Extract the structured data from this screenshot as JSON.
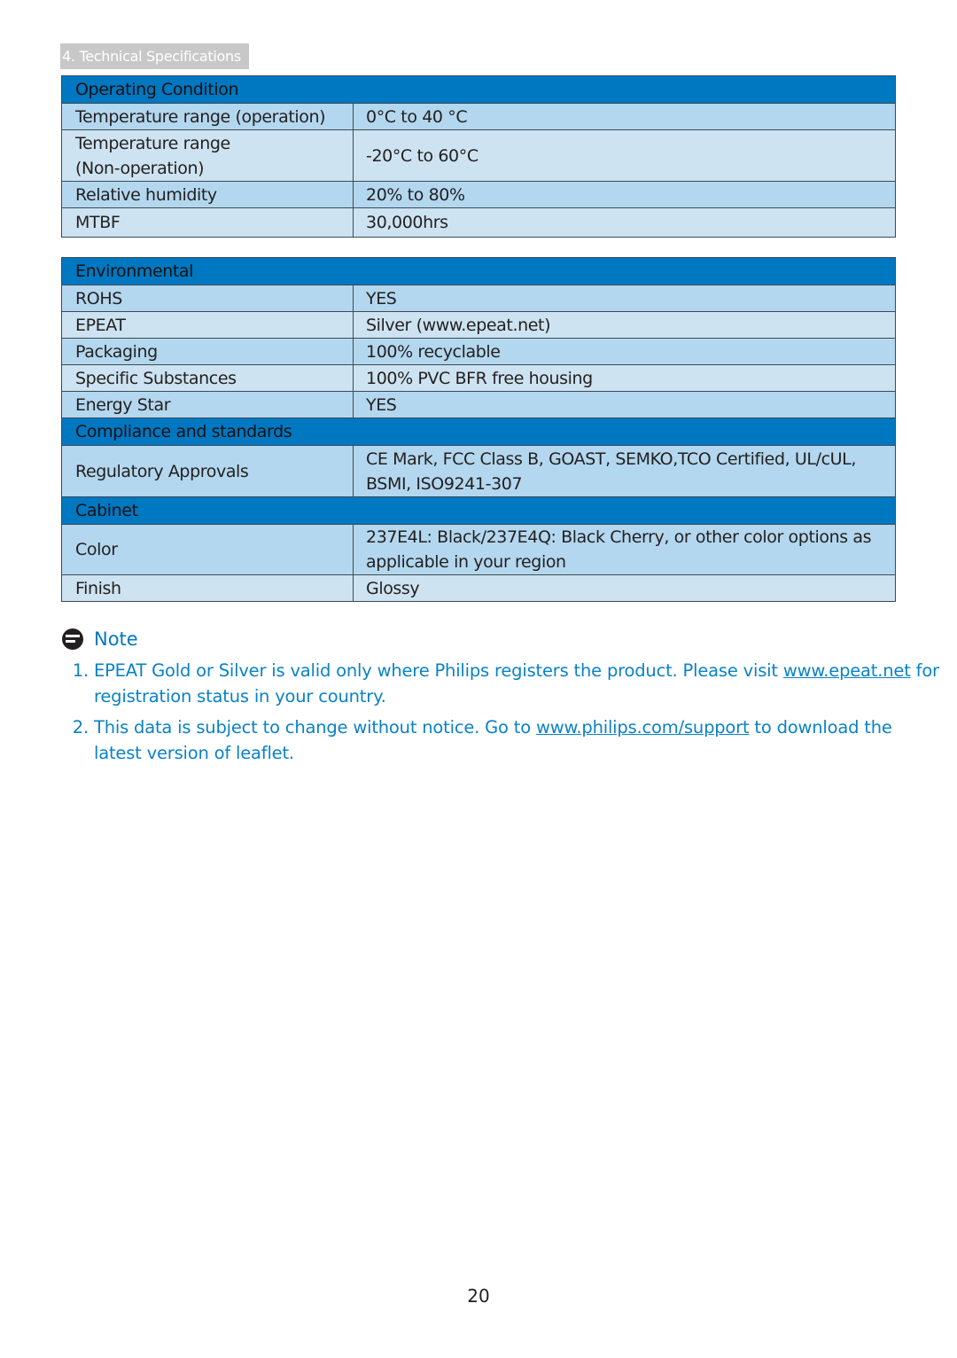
{
  "section_tab": "4. Technical Specifications",
  "tables": [
    {
      "sections": [
        {
          "title": "Operating Condition",
          "rows": [
            {
              "label": "Temperature range (operation)",
              "value": "0°C to 40 °C"
            },
            {
              "label_lines": [
                "Temperature range",
                "(Non-operation)"
              ],
              "value": "-20°C to 60°C"
            },
            {
              "label": "Relative humidity",
              "value": "20% to 80%"
            },
            {
              "label": "MTBF",
              "value": "30,000hrs"
            }
          ]
        }
      ]
    },
    {
      "sections": [
        {
          "title": "Environmental",
          "rows": [
            {
              "label": "ROHS",
              "value": "YES"
            },
            {
              "label": "EPEAT",
              "value": "Silver (www.epeat.net)"
            },
            {
              "label": "Packaging",
              "value": "100% recyclable"
            },
            {
              "label": "Specific Substances",
              "value": "100% PVC BFR free housing"
            },
            {
              "label": "Energy Star",
              "value": "YES"
            }
          ]
        },
        {
          "title": "Compliance and standards",
          "rows": [
            {
              "label": "Regulatory Approvals",
              "value_lines": [
                "CE Mark, FCC Class B, GOAST, SEMKO,TCO Certified, UL/cUL,",
                "BSMI, ISO9241-307"
              ]
            }
          ]
        },
        {
          "title": "Cabinet",
          "rows": [
            {
              "label": "Color",
              "value_lines": [
                "237E4L: Black/237E4Q: Black Cherry, or other color options as",
                "applicable in your region"
              ]
            },
            {
              "label": "Finish",
              "value": "Glossy"
            }
          ]
        }
      ]
    }
  ],
  "note": {
    "title": "Note",
    "items": [
      {
        "text_before": "EPEAT Gold or Silver is valid only where Philips registers the product. Please visit ",
        "link": "www.epeat.net",
        "text_after": " for registration status in your country."
      },
      {
        "text_before": "This data is subject to change without notice. Go to ",
        "link": "www.philips.com/support",
        "text_after": " to download the latest version of leaflet."
      }
    ]
  },
  "colors": {
    "header_blue": "#0077c1",
    "row_dark": "#b3d7ee",
    "row_light": "#cde3f1",
    "note_text": "#0a82c6"
  },
  "page_number": "20"
}
